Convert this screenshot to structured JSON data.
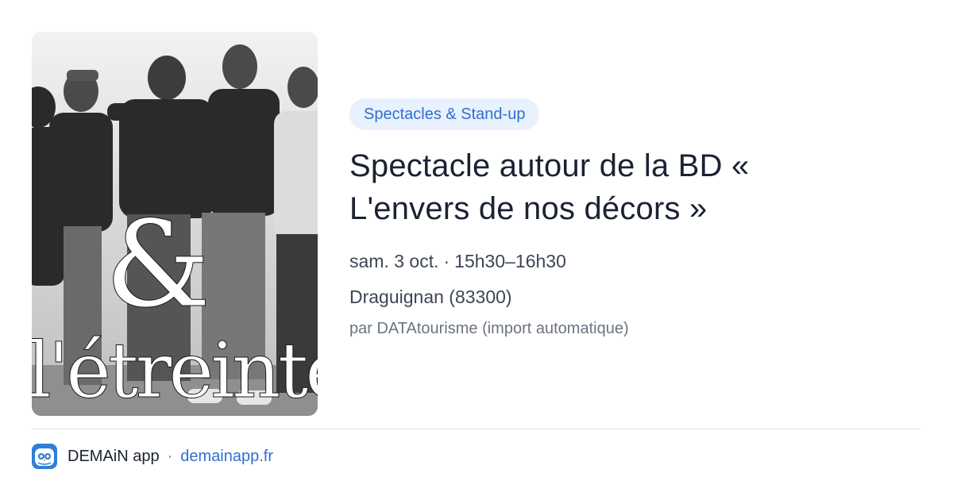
{
  "event": {
    "image_text": "&\nl'étreinte",
    "category": "Spectacles & Stand-up",
    "title_line1": "Spectacle autour de la BD «",
    "title_line2": "L'envers de nos décors »",
    "date": "sam. 3 oct.",
    "time": "15h30–16h30",
    "location": "Draguignan (83300)",
    "source": "par DATAtourisme (import automatique)"
  },
  "footer": {
    "app_name": "DEMAiN app",
    "separator": "·",
    "link": "demainapp.fr"
  },
  "colors": {
    "accent": "#2f6fd0",
    "pill_bg": "#e8f1fd",
    "title": "#1a2233",
    "muted": "#6b7383"
  },
  "icons": {
    "app_icon": "owl-icon"
  }
}
